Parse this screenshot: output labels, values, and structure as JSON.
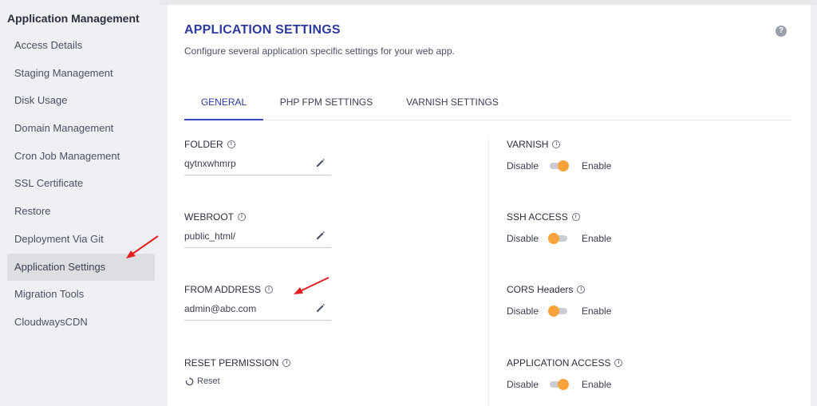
{
  "sidebar": {
    "title": "Application Management",
    "items": [
      {
        "label": "Access Details"
      },
      {
        "label": "Staging Management"
      },
      {
        "label": "Disk Usage"
      },
      {
        "label": "Domain Management"
      },
      {
        "label": "Cron Job Management"
      },
      {
        "label": "SSL Certificate"
      },
      {
        "label": "Restore"
      },
      {
        "label": "Deployment Via Git"
      },
      {
        "label": "Application Settings",
        "active": true
      },
      {
        "label": "Migration Tools"
      },
      {
        "label": "CloudwaysCDN"
      }
    ]
  },
  "main": {
    "title": "APPLICATION SETTINGS",
    "subtitle": "Configure several application specific settings for your web app.",
    "help_icon": "?",
    "tabs": [
      {
        "label": "GENERAL",
        "active": true
      },
      {
        "label": "PHP FPM SETTINGS"
      },
      {
        "label": "VARNISH SETTINGS"
      }
    ]
  },
  "fields": {
    "folder": {
      "label": "FOLDER",
      "value": "qytnxwhmrp"
    },
    "webroot": {
      "label": "WEBROOT",
      "value": "public_html/"
    },
    "from_address": {
      "label": "FROM ADDRESS",
      "value": "admin@abc.com"
    },
    "reset_permission": {
      "label": "RESET PERMISSION",
      "action": "Reset"
    }
  },
  "toggles": {
    "disable_label": "Disable",
    "enable_label": "Enable",
    "varnish": {
      "label": "VARNISH",
      "state": "on"
    },
    "ssh_access": {
      "label": "SSH ACCESS",
      "state": "off"
    },
    "cors_headers": {
      "label": "CORS Headers",
      "state": "off"
    },
    "application_access": {
      "label": "APPLICATION ACCESS",
      "state": "on"
    }
  },
  "icons": {
    "info": "i",
    "edit": "pencil-icon",
    "refresh": "refresh-icon",
    "arrow": "annotation-arrow"
  },
  "colors": {
    "accent": "#2f3a9e",
    "toggle_knob": "#f7a33a",
    "arrow": "#e02020"
  }
}
